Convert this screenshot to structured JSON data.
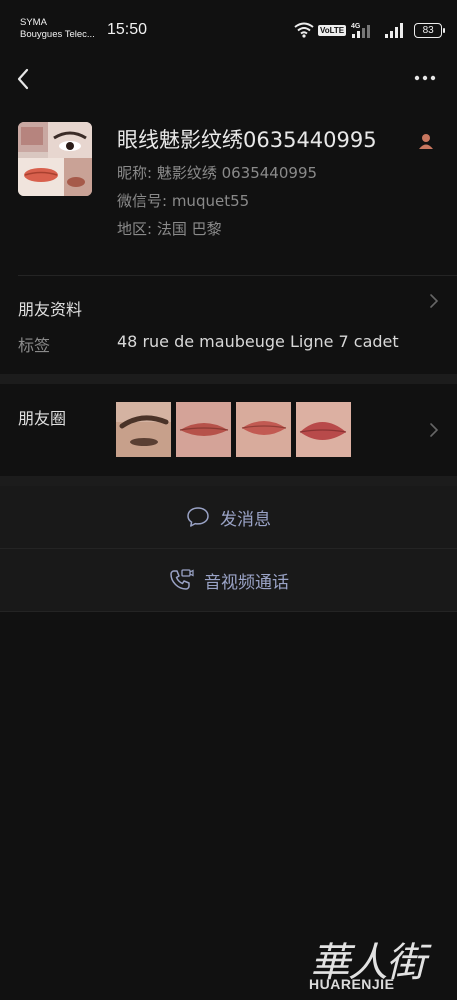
{
  "status_bar": {
    "carrier_line1": "SYMA",
    "carrier_line2": "Bouygues Telec...",
    "time": "15:50",
    "network": "4G",
    "volte": "VoLTE",
    "battery": "83"
  },
  "top_bar": {
    "back_icon": "chevron-left-icon",
    "more_icon": "more-dots-icon"
  },
  "profile": {
    "name": "眼线魅影纹绣0635440995",
    "nickname_line": "昵称:  魅影纹绣 0635440995",
    "wechat_id_line": "微信号:  muquet55",
    "region_line": "地区:  法国  巴黎",
    "gender_icon": "male-user-icon"
  },
  "friend_info": {
    "title": "朋友资料",
    "tag_label": "标签",
    "tag_value": "48 rue de maubeuge  Ligne 7 cadet"
  },
  "moments": {
    "title": "朋友圈",
    "photos": [
      "eyebrow-photo",
      "lips-photo-1",
      "lips-photo-2",
      "lips-photo-3"
    ]
  },
  "actions": {
    "message": "发消息",
    "call": "音视频通话"
  },
  "watermark": {
    "hanzi": "華人街",
    "latin": "HUARENJIE"
  },
  "colors": {
    "background": "#111111",
    "section_gap": "#1c1c1c",
    "action_text": "#9aa3c6",
    "secondary_text": "#8a8a8a"
  }
}
